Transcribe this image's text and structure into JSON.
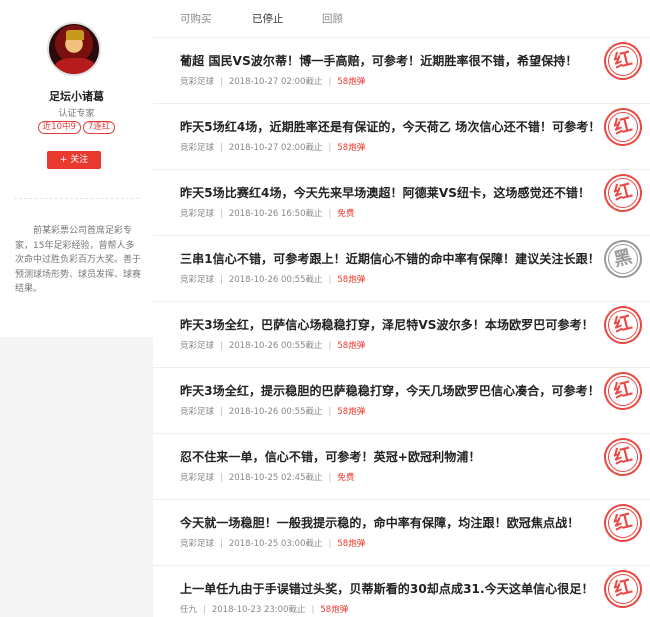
{
  "profile": {
    "name": "足坛小诸葛",
    "title": "认证专家",
    "badges": [
      "近10中9",
      "7连红"
    ],
    "follow_label": "+ 关注",
    "bio": "前某彩票公司首席足彩专家，15年足彩经验，曾帮人多次命中过胜负彩百万大奖。善于预测球场形势、球员发挥、球赛结果。"
  },
  "tabs": [
    {
      "label": "可购买",
      "active": false
    },
    {
      "label": "已停止",
      "active": true
    },
    {
      "label": "回顾",
      "active": false
    }
  ],
  "items": [
    {
      "title": "葡超 国民VS波尔蒂！博一手高赔，可参考！近期胜率很不错，希望保持！",
      "category": "竞彩足球",
      "time": "2018-10-27 02:00截止",
      "price": "58炮弹",
      "stamp": "红",
      "stamp_color": "#e94a43"
    },
    {
      "title": "昨天5场红4场，近期胜率还是有保证的，今天荷乙 场次信心还不错！可参考！",
      "category": "竞彩足球",
      "time": "2018-10-27 02:00截止",
      "price": "58炮弹",
      "stamp": "红",
      "stamp_color": "#e94a43"
    },
    {
      "title": "昨天5场比赛红4场，今天先来早场澳超！阿德莱VS纽卡，这场感觉还不错！",
      "category": "竞彩足球",
      "time": "2018-10-26 16:50截止",
      "price": "免费",
      "stamp": "红",
      "stamp_color": "#e94a43"
    },
    {
      "title": "三串1信心不错，可参考跟上！近期信心不错的命中率有保障！建议关注长跟！",
      "category": "竞彩足球",
      "time": "2018-10-26 00:55截止",
      "price": "58炮弹",
      "stamp": "黑",
      "stamp_color": "#9a9a9a"
    },
    {
      "title": "昨天3场全红，巴萨信心场稳稳打穿，泽尼特VS波尔多！本场欧罗巴可参考！",
      "category": "竞彩足球",
      "time": "2018-10-26 00:55截止",
      "price": "58炮弹",
      "stamp": "红",
      "stamp_color": "#e94a43"
    },
    {
      "title": "昨天3场全红，提示稳胆的巴萨稳稳打穿，今天几场欧罗巴信心凑合，可参考！",
      "category": "竞彩足球",
      "time": "2018-10-26 00:55截止",
      "price": "58炮弹",
      "stamp": "红",
      "stamp_color": "#e94a43"
    },
    {
      "title": "忍不住来一单，信心不错，可参考！英冠+欧冠利物浦！",
      "category": "竞彩足球",
      "time": "2018-10-25 02:45截止",
      "price": "免费",
      "stamp": "红",
      "stamp_color": "#e94a43"
    },
    {
      "title": "今天就一场稳胆！一般我提示稳的，命中率有保障，均注跟！欧冠焦点战！",
      "category": "竞彩足球",
      "time": "2018-10-25 03:00截止",
      "price": "58炮弹",
      "stamp": "红",
      "stamp_color": "#e94a43"
    },
    {
      "title": "上一单任九由于手误错过头奖，贝蒂斯看的30却点成31.今天这单信心很足！",
      "category": "任九",
      "time": "2018-10-23 23:00截止",
      "price": "58炮弹",
      "stamp": "红",
      "stamp_color": "#e94a43"
    }
  ]
}
